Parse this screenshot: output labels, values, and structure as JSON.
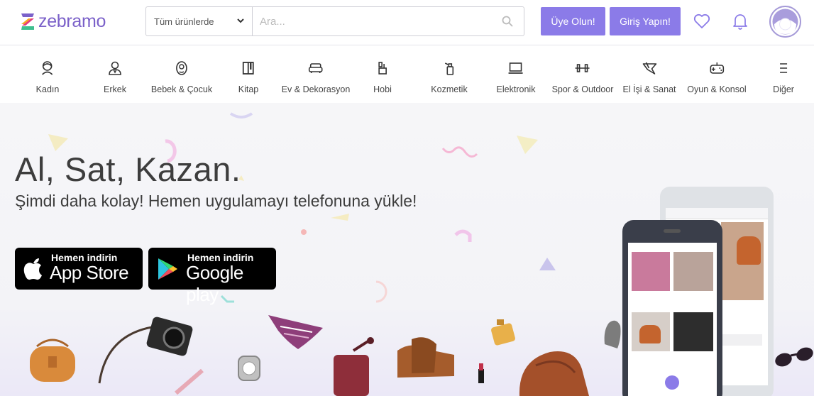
{
  "brand": {
    "name": "zebramo"
  },
  "search": {
    "category": "Tüm ürünlerde",
    "placeholder": "Ara..."
  },
  "header": {
    "signup_label": "Üye Olun!",
    "login_label": "Giriş Yapın!"
  },
  "categories": [
    {
      "label": "Kadın",
      "icon": "woman-icon"
    },
    {
      "label": "Erkek",
      "icon": "man-icon"
    },
    {
      "label": "Bebek & Çocuk",
      "icon": "baby-icon"
    },
    {
      "label": "Kitap",
      "icon": "book-icon"
    },
    {
      "label": "Ev & Dekorasyon",
      "icon": "sofa-icon"
    },
    {
      "label": "Hobi",
      "icon": "hobby-icon"
    },
    {
      "label": "Kozmetik",
      "icon": "cosmetic-icon"
    },
    {
      "label": "Elektronik",
      "icon": "laptop-icon"
    },
    {
      "label": "Spor & Outdoor",
      "icon": "dumbbell-icon"
    },
    {
      "label": "El İşi & Sanat",
      "icon": "craft-icon"
    },
    {
      "label": "Oyun & Konsol",
      "icon": "gamepad-icon"
    },
    {
      "label": "Diğer",
      "icon": "menu-icon"
    }
  ],
  "hero": {
    "title": "Al, Sat, Kazan.",
    "subtitle": "Şimdi daha kolay! Hemen uygulamayı telefonuna yükle!",
    "appstore": {
      "small": "Hemen indirin",
      "big": "App Store"
    },
    "googleplay": {
      "small": "Hemen indirin",
      "big": "Google play"
    }
  },
  "colors": {
    "accent": "#8b7be8",
    "brand": "#7b61c9",
    "text": "#3d3d3d"
  }
}
